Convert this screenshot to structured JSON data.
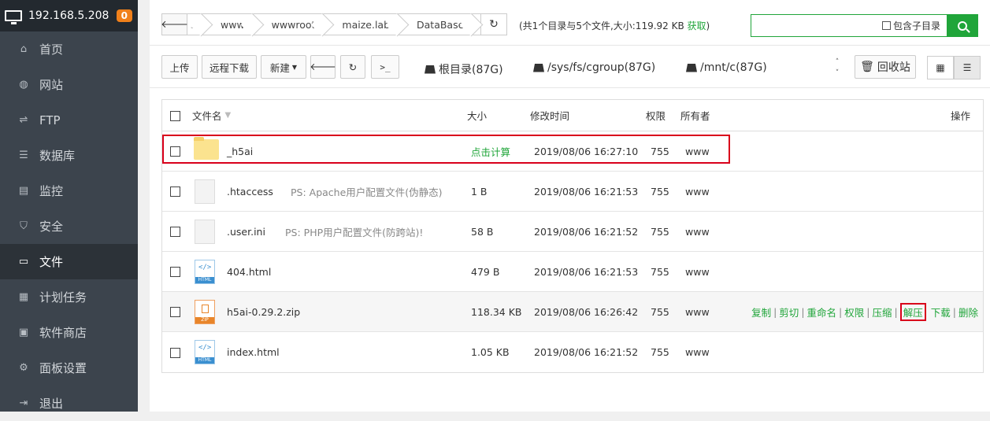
{
  "sidebar": {
    "host": "192.168.5.208",
    "badge": "0",
    "items": [
      {
        "label": "首页",
        "icon": "home-icon"
      },
      {
        "label": "网站",
        "icon": "globe-icon"
      },
      {
        "label": "FTP",
        "icon": "ftp-icon"
      },
      {
        "label": "数据库",
        "icon": "database-icon"
      },
      {
        "label": "监控",
        "icon": "monitor-chart-icon"
      },
      {
        "label": "安全",
        "icon": "shield-icon"
      },
      {
        "label": "文件",
        "icon": "folder-icon"
      },
      {
        "label": "计划任务",
        "icon": "calendar-icon"
      },
      {
        "label": "软件商店",
        "icon": "grid-icon"
      },
      {
        "label": "面板设置",
        "icon": "settings-icon"
      },
      {
        "label": "退出",
        "icon": "logout-icon"
      }
    ],
    "active_index": 6
  },
  "path": {
    "crumbs": [
      "s",
      "www",
      "wwwroot",
      "maize.lab",
      "DataBase"
    ]
  },
  "summary": {
    "text": "(共1个目录与5个文件,大小:119.92 KB ",
    "link": "获取",
    "close": ")"
  },
  "search": {
    "include_sub": "包含子目录"
  },
  "toolbar": {
    "upload": "上传",
    "remote_download": "远程下载",
    "new": "新建",
    "disks": [
      "根目录(87G)",
      "/sys/fs/cgroup(87G)",
      "/mnt/c(87G)"
    ],
    "recycle": "回收站"
  },
  "table": {
    "headers": {
      "name": "文件名",
      "size": "大小",
      "mtime": "修改时间",
      "perm": "权限",
      "owner": "所有者",
      "ops": "操作"
    },
    "rows": [
      {
        "name": "_h5ai",
        "ps": "",
        "size": "点击计算",
        "mtime": "2019/08/06 16:27:10",
        "perm": "755",
        "owner": "www",
        "type": "folder"
      },
      {
        "name": ".htaccess",
        "ps": "PS: Apache用户配置文件(伪静态)",
        "size": "1 B",
        "mtime": "2019/08/06 16:21:53",
        "perm": "755",
        "owner": "www",
        "type": "doc"
      },
      {
        "name": ".user.ini",
        "ps": "PS: PHP用户配置文件(防跨站)!",
        "size": "58 B",
        "mtime": "2019/08/06 16:21:52",
        "perm": "755",
        "owner": "www",
        "type": "doc"
      },
      {
        "name": "404.html",
        "ps": "",
        "size": "479 B",
        "mtime": "2019/08/06 16:21:53",
        "perm": "755",
        "owner": "www",
        "type": "html"
      },
      {
        "name": "h5ai-0.29.2.zip",
        "ps": "",
        "size": "118.34 KB",
        "mtime": "2019/08/06 16:26:42",
        "perm": "755",
        "owner": "www",
        "type": "zip"
      },
      {
        "name": "index.html",
        "ps": "",
        "size": "1.05 KB",
        "mtime": "2019/08/06 16:21:52",
        "perm": "755",
        "owner": "www",
        "type": "html"
      }
    ],
    "row_ops": [
      "复制",
      "剪切",
      "重命名",
      "权限",
      "压缩",
      "解压",
      "下载",
      "删除"
    ],
    "file_icon_labels": {
      "html_tag": "</>",
      "html": "HTML",
      "zip": "ZIP"
    }
  },
  "colors": {
    "accent": "#20a53a",
    "highlight": "#d9001b",
    "sidebar": "#3c444d"
  }
}
